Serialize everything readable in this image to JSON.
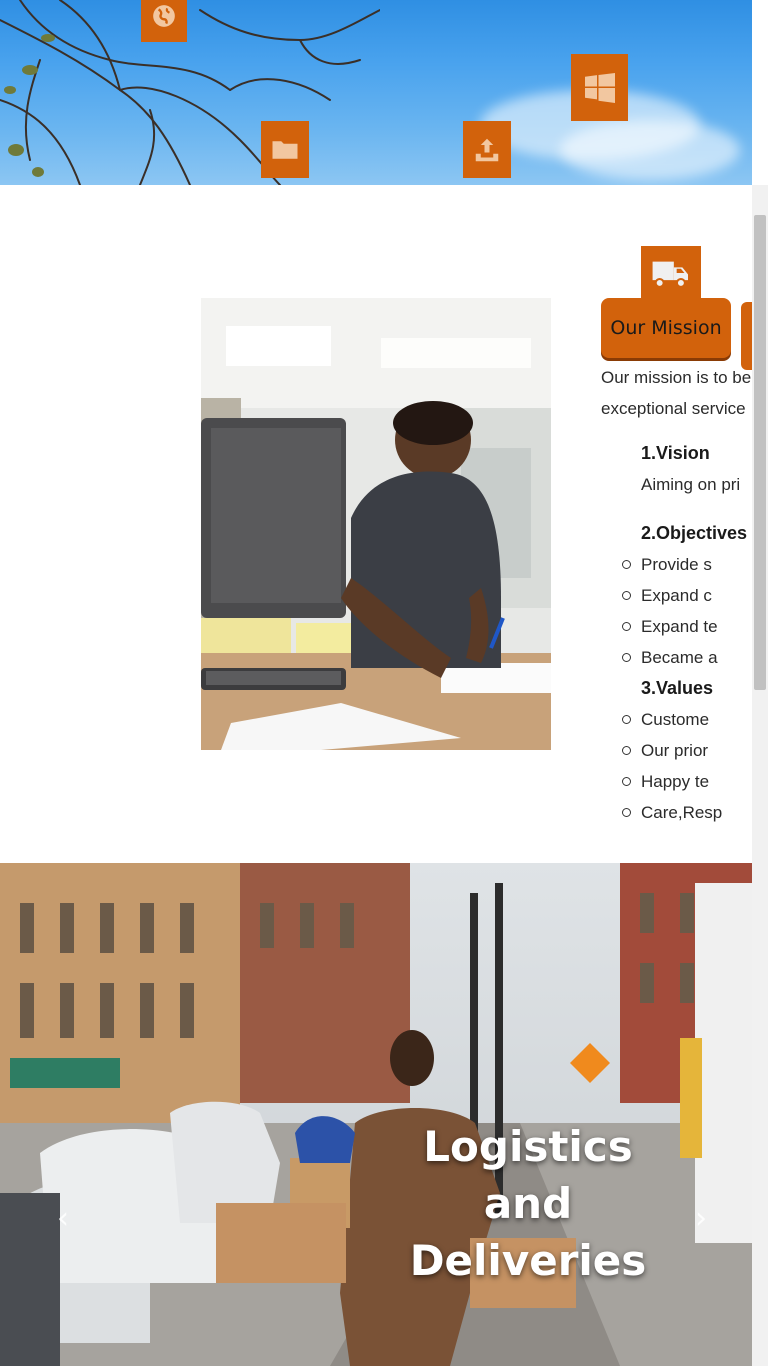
{
  "hero": {
    "icons": [
      "globe-icon",
      "windows-icon",
      "folder-icon",
      "upload-icon"
    ],
    "accent_color": "#d2620c"
  },
  "mission": {
    "truck_icon": "truck-icon",
    "button_label": "Our Mission",
    "intro_line1": "Our mission is to be",
    "intro_line2": "exceptional service"
  },
  "goals": {
    "vision": {
      "heading": "1.Vision",
      "text": "Aiming on pri"
    },
    "objectives": {
      "heading": "2.Objectives",
      "items": [
        "Provide s",
        "Expand c",
        "Expand te",
        "Became a"
      ]
    },
    "values": {
      "heading": "3.Values",
      "items": [
        "Custome",
        "Our prior",
        "Happy te",
        "Care,Resp"
      ]
    }
  },
  "carousel": {
    "caption_line1": "Logistics",
    "caption_line2": "and",
    "caption_line3": "Deliveries",
    "prev_symbol": "‹",
    "next_symbol": "›"
  }
}
